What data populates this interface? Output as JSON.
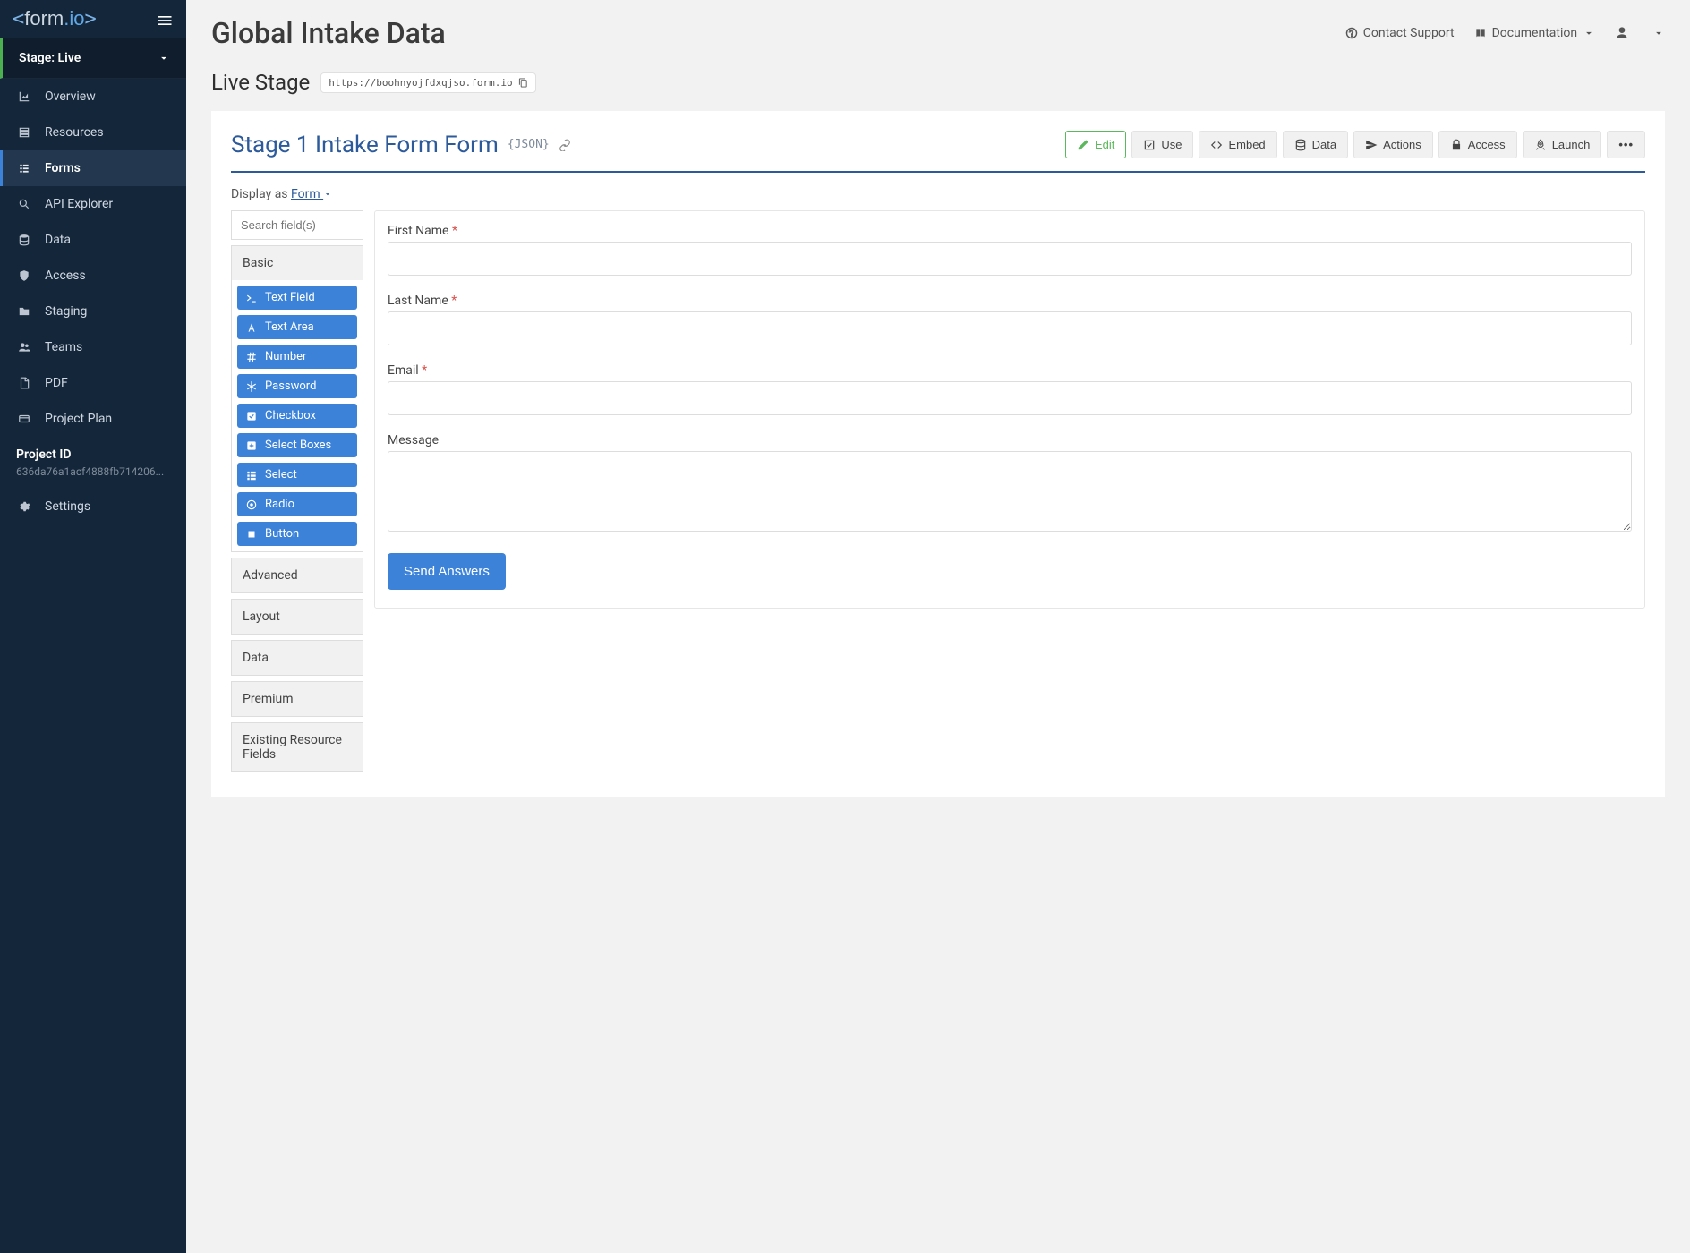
{
  "logo": {
    "lt": "<",
    "form": "form",
    "dot": ".",
    "io": "io",
    "gt": ">"
  },
  "sidebar": {
    "stage_label": "Stage: Live",
    "items": [
      {
        "icon": "area-chart-icon",
        "label": "Overview"
      },
      {
        "icon": "sitemap-icon",
        "label": "Resources"
      },
      {
        "icon": "forms-icon",
        "label": "Forms",
        "active": true
      },
      {
        "icon": "search-icon",
        "label": "API Explorer"
      },
      {
        "icon": "database-icon",
        "label": "Data"
      },
      {
        "icon": "shield-icon",
        "label": "Access"
      },
      {
        "icon": "folder-icon",
        "label": "Staging"
      },
      {
        "icon": "users-icon",
        "label": "Teams"
      },
      {
        "icon": "file-pdf-icon",
        "label": "PDF"
      },
      {
        "icon": "card-icon",
        "label": "Project Plan"
      }
    ],
    "project_id_label": "Project ID",
    "project_id_value": "636da76a1acf4888fb714206...",
    "settings_label": "Settings"
  },
  "topbar": {
    "title": "Global Intake Data",
    "contact_support": "Contact Support",
    "documentation": "Documentation"
  },
  "stage": {
    "label": "Live Stage",
    "url": "https://boohnyojfdxqjso.form.io"
  },
  "form": {
    "title": "Stage 1 Intake Form Form",
    "json_badge": "{JSON}",
    "buttons": {
      "edit": "Edit",
      "use": "Use",
      "embed": "Embed",
      "data": "Data",
      "actions": "Actions",
      "access": "Access",
      "launch": "Launch"
    },
    "display_as_label": "Display as ",
    "display_as_value": "Form"
  },
  "palette": {
    "search_placeholder": "Search field(s)",
    "groups": {
      "basic": {
        "label": "Basic",
        "items": [
          {
            "icon": "terminal-icon",
            "label": "Text Field"
          },
          {
            "icon": "font-icon",
            "label": "Text Area"
          },
          {
            "icon": "hash-icon",
            "label": "Number"
          },
          {
            "icon": "asterisk-icon",
            "label": "Password"
          },
          {
            "icon": "check-square-icon",
            "label": "Checkbox"
          },
          {
            "icon": "plus-square-icon",
            "label": "Select Boxes"
          },
          {
            "icon": "th-list-icon",
            "label": "Select"
          },
          {
            "icon": "dot-circle-icon",
            "label": "Radio"
          },
          {
            "icon": "stop-icon",
            "label": "Button"
          }
        ]
      },
      "advanced": {
        "label": "Advanced"
      },
      "layout": {
        "label": "Layout"
      },
      "data": {
        "label": "Data"
      },
      "premium": {
        "label": "Premium"
      },
      "existing": {
        "label": "Existing Resource Fields"
      }
    }
  },
  "canvas": {
    "fields": [
      {
        "key": "first_name",
        "label": "First Name",
        "required": true,
        "type": "text"
      },
      {
        "key": "last_name",
        "label": "Last Name",
        "required": true,
        "type": "text"
      },
      {
        "key": "email",
        "label": "Email",
        "required": true,
        "type": "text"
      },
      {
        "key": "message",
        "label": "Message",
        "required": false,
        "type": "textarea"
      }
    ],
    "submit_label": "Send Answers"
  }
}
